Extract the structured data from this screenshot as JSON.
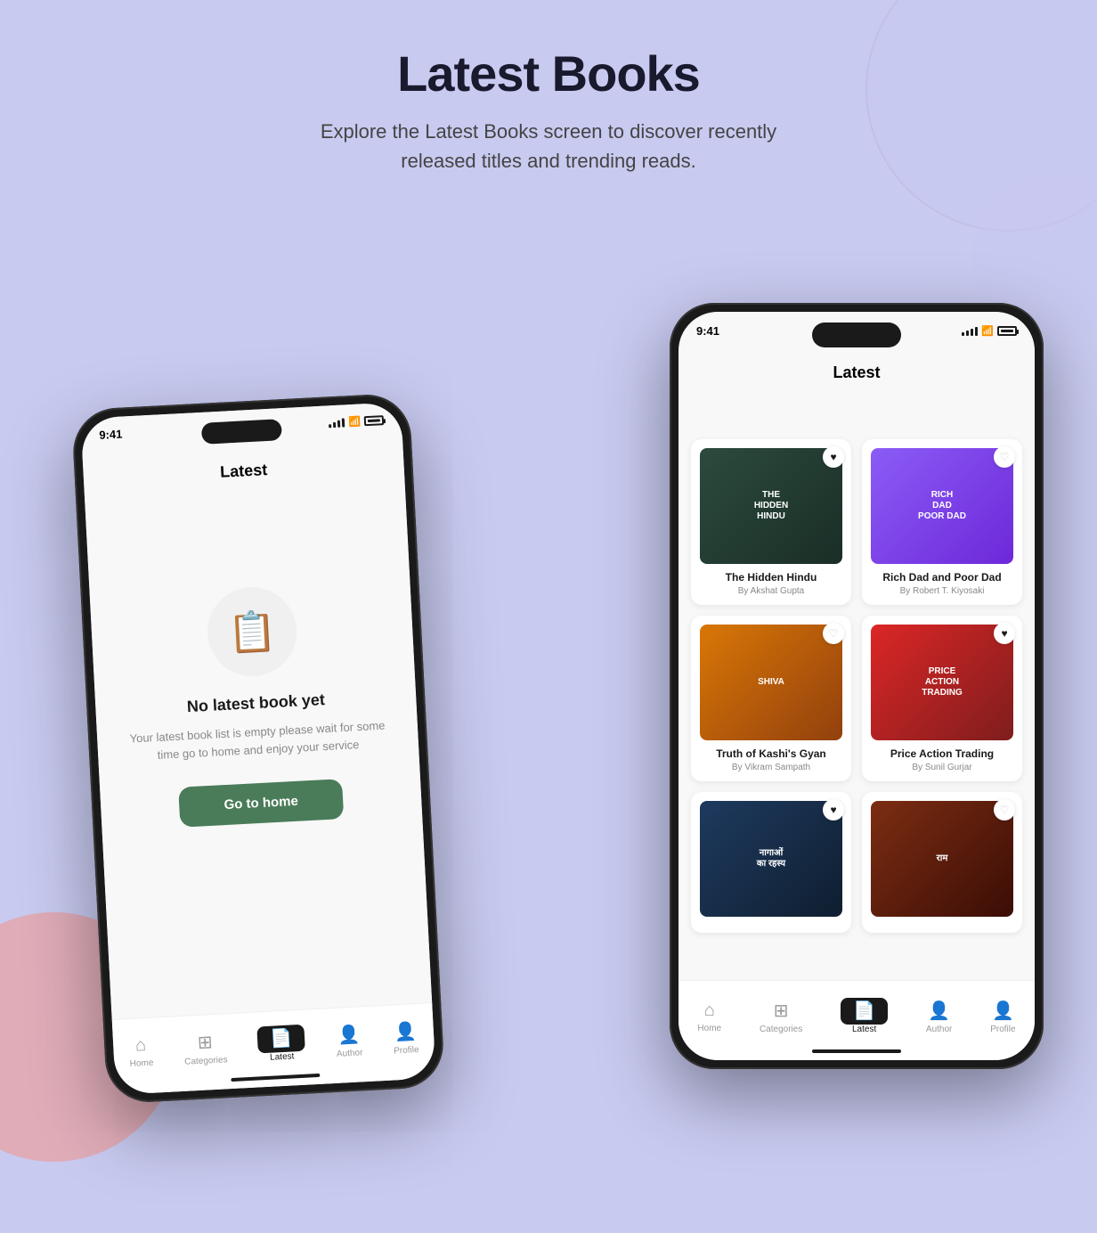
{
  "page": {
    "title": "Latest Books",
    "subtitle": "Explore the Latest Books screen to discover recently released titles and trending reads."
  },
  "left_phone": {
    "status_time": "9:41",
    "screen_title": "Latest",
    "empty_state": {
      "title": "No latest book yet",
      "description": "Your latest book list is empty please wait for some time go to home and enjoy your service",
      "button_label": "Go to home"
    },
    "nav_items": [
      {
        "label": "Home",
        "icon": "⌂",
        "active": false
      },
      {
        "label": "Categories",
        "icon": "⊞",
        "active": false
      },
      {
        "label": "Latest",
        "icon": "📄",
        "active": true
      },
      {
        "label": "Author",
        "icon": "👤",
        "active": false
      },
      {
        "label": "Profile",
        "icon": "👤",
        "active": false
      }
    ]
  },
  "right_phone": {
    "status_time": "9:41",
    "screen_title": "Latest",
    "books": [
      {
        "title": "The Hidden Hindu",
        "author": "By Akshat Gupta",
        "cover_class": "cover-hidden-hindu",
        "liked": true,
        "cover_text": "THE\nHIDDEN\nHINDU"
      },
      {
        "title": "Rich Dad and Poor Dad",
        "author": "By Robert T. Kiyosaki",
        "cover_class": "cover-rich-dad",
        "liked": false,
        "cover_text": "RICH\nDAD\nPOOR DAD"
      },
      {
        "title": "Truth of Kashi's Gyan",
        "author": "By Vikram Sampath",
        "cover_class": "cover-shiva",
        "liked": false,
        "cover_text": "SHIVA"
      },
      {
        "title": "Price Action Trading",
        "author": "By Sunil Gurjar",
        "cover_class": "cover-price-action",
        "liked": true,
        "cover_text": "PRICE ACTION\nTRADING"
      },
      {
        "title": "",
        "author": "",
        "cover_class": "cover-naagas",
        "liked": true,
        "cover_text": "नागाओं\nका रहस्य"
      },
      {
        "title": "",
        "author": "",
        "cover_class": "cover-ram",
        "liked": false,
        "cover_text": "राम"
      }
    ],
    "nav_items": [
      {
        "label": "Home",
        "icon": "⌂",
        "active": false
      },
      {
        "label": "Categories",
        "icon": "⊞",
        "active": false
      },
      {
        "label": "Latest",
        "icon": "📄",
        "active": true
      },
      {
        "label": "Author",
        "icon": "👤",
        "active": false
      },
      {
        "label": "Profile",
        "icon": "👤",
        "active": false
      }
    ]
  },
  "colors": {
    "background": "#c8caf0",
    "go_home_button": "#4a7c59",
    "active_nav": "#1a1a1a"
  }
}
